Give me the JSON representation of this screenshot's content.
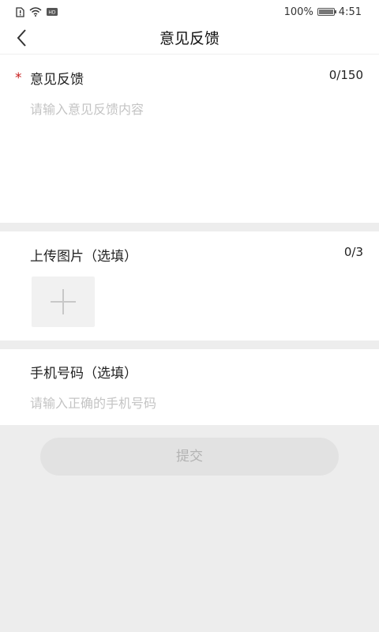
{
  "status_bar": {
    "battery_percent": "100%",
    "battery_level": 1.0,
    "time": "4:51",
    "hd_badge": "HD"
  },
  "header": {
    "title": "意见反馈"
  },
  "feedback": {
    "required_mark": "*",
    "label": "意见反馈",
    "counter": "0/150",
    "placeholder": "请输入意见反馈内容"
  },
  "upload": {
    "label": "上传图片（选填）",
    "counter": "0/3"
  },
  "phone": {
    "label": "手机号码（选填）",
    "placeholder": "请输入正确的手机号码"
  },
  "submit": {
    "label": "提交"
  },
  "colors": {
    "required": "#c81e1e",
    "placeholder": "#c4c4c4",
    "page_background": "#ededed",
    "button_disabled_bg": "#e2e2e2",
    "button_disabled_text": "#b3b3b3"
  }
}
